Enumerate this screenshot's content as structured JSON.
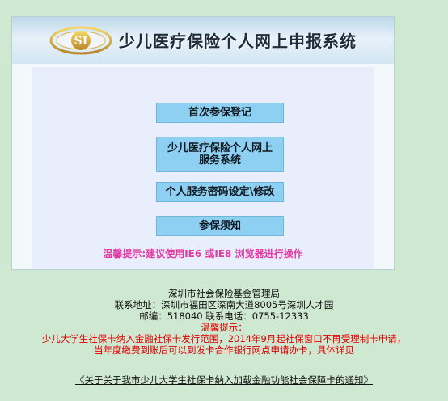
{
  "header": {
    "title": "少儿医疗保险个人网上申报系统",
    "logo_text": "SI"
  },
  "menu": {
    "first_enroll": "首次参保登记",
    "online_service": "少儿医疗保险个人网上服务系统",
    "password_setup": "个人服务密码设定\\修改",
    "enroll_notes": "参保须知"
  },
  "browser_tip": "温馨提示:建议使用IE6 或IE8 浏览器进行操作",
  "footer": {
    "org": "深圳市社会保险基金管理局",
    "address": "联系地址：深圳市福田区深南大道8005号深圳人才园",
    "contact": "邮编：518040 联系电话：0755-12333",
    "tip_label": "温馨提示：",
    "tip_line1": "少儿大学生社保卡纳入金融社保卡发行范围，2014年9月起社保窗口不再受理制卡申请，",
    "tip_line2": "当年度缴费到账后可以到发卡合作银行网点申请办卡，具体详见",
    "notice_link": "《关于关于我市少儿大学生社保卡纳入加载金融功能社会保障卡的通知》"
  },
  "colors": {
    "background": "#cfe8d1",
    "button": "#8dd0f1",
    "tip_pink": "#e23aa5",
    "warning_red": "#e00000"
  }
}
